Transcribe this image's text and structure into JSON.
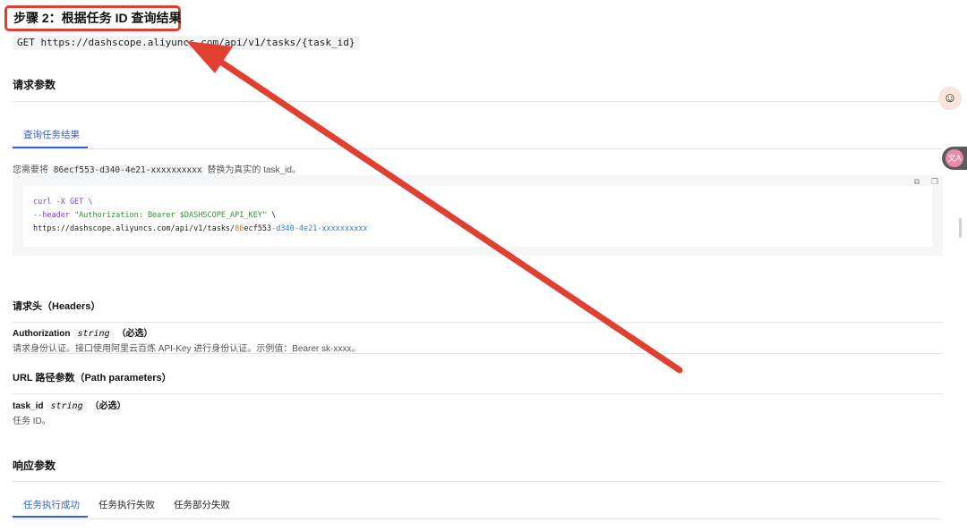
{
  "step": {
    "title": "步骤 2：根据任务 ID 查询结果",
    "endpoint": "GET https://dashscope.aliyuncs.com/api/v1/tasks/{task_id}"
  },
  "request_params": {
    "title": "请求参数",
    "tab_label": "查询任务结果",
    "note_prefix": "您需要将 ",
    "note_code": "86ecf553-d340-4e21-xxxxxxxxxx",
    "note_suffix": " 替换为真实的 task_id。",
    "code": {
      "line1_cmd": "curl -X GET \\",
      "line2_flag": "--header ",
      "line2_value": "\"Authorization: Bearer $DASHSCOPE_API_KEY\"",
      "line2_tail": " \\",
      "line3_prefix": "https://dashscope.aliyuncs.com/api/v1/tasks/",
      "line3_num": "86",
      "line3_mid": "ecf553",
      "line3_tail": "-d340-4e21-xxxxxxxxxx"
    },
    "icons": [
      "expand-icon",
      "copy-icon"
    ]
  },
  "headers": {
    "title": "请求头（Headers）",
    "param_name": "Authorization",
    "param_type": "string",
    "param_required": "（必选）",
    "param_desc": "请求身份认证。接口使用阿里云百炼 API-Key 进行身份认证。示例值：Bearer sk-xxxx。"
  },
  "path_params": {
    "title": "URL 路径参数（Path parameters）",
    "param_name": "task_id",
    "param_type": "string",
    "param_required": "（必选）",
    "param_desc": "任务 ID。"
  },
  "response_params": {
    "title": "响应参数",
    "tabs": [
      "任务执行成功",
      "任务执行失败",
      "任务部分失败"
    ]
  },
  "colors": {
    "annotation": "#e0402f",
    "accent": "#2f5fd6"
  }
}
